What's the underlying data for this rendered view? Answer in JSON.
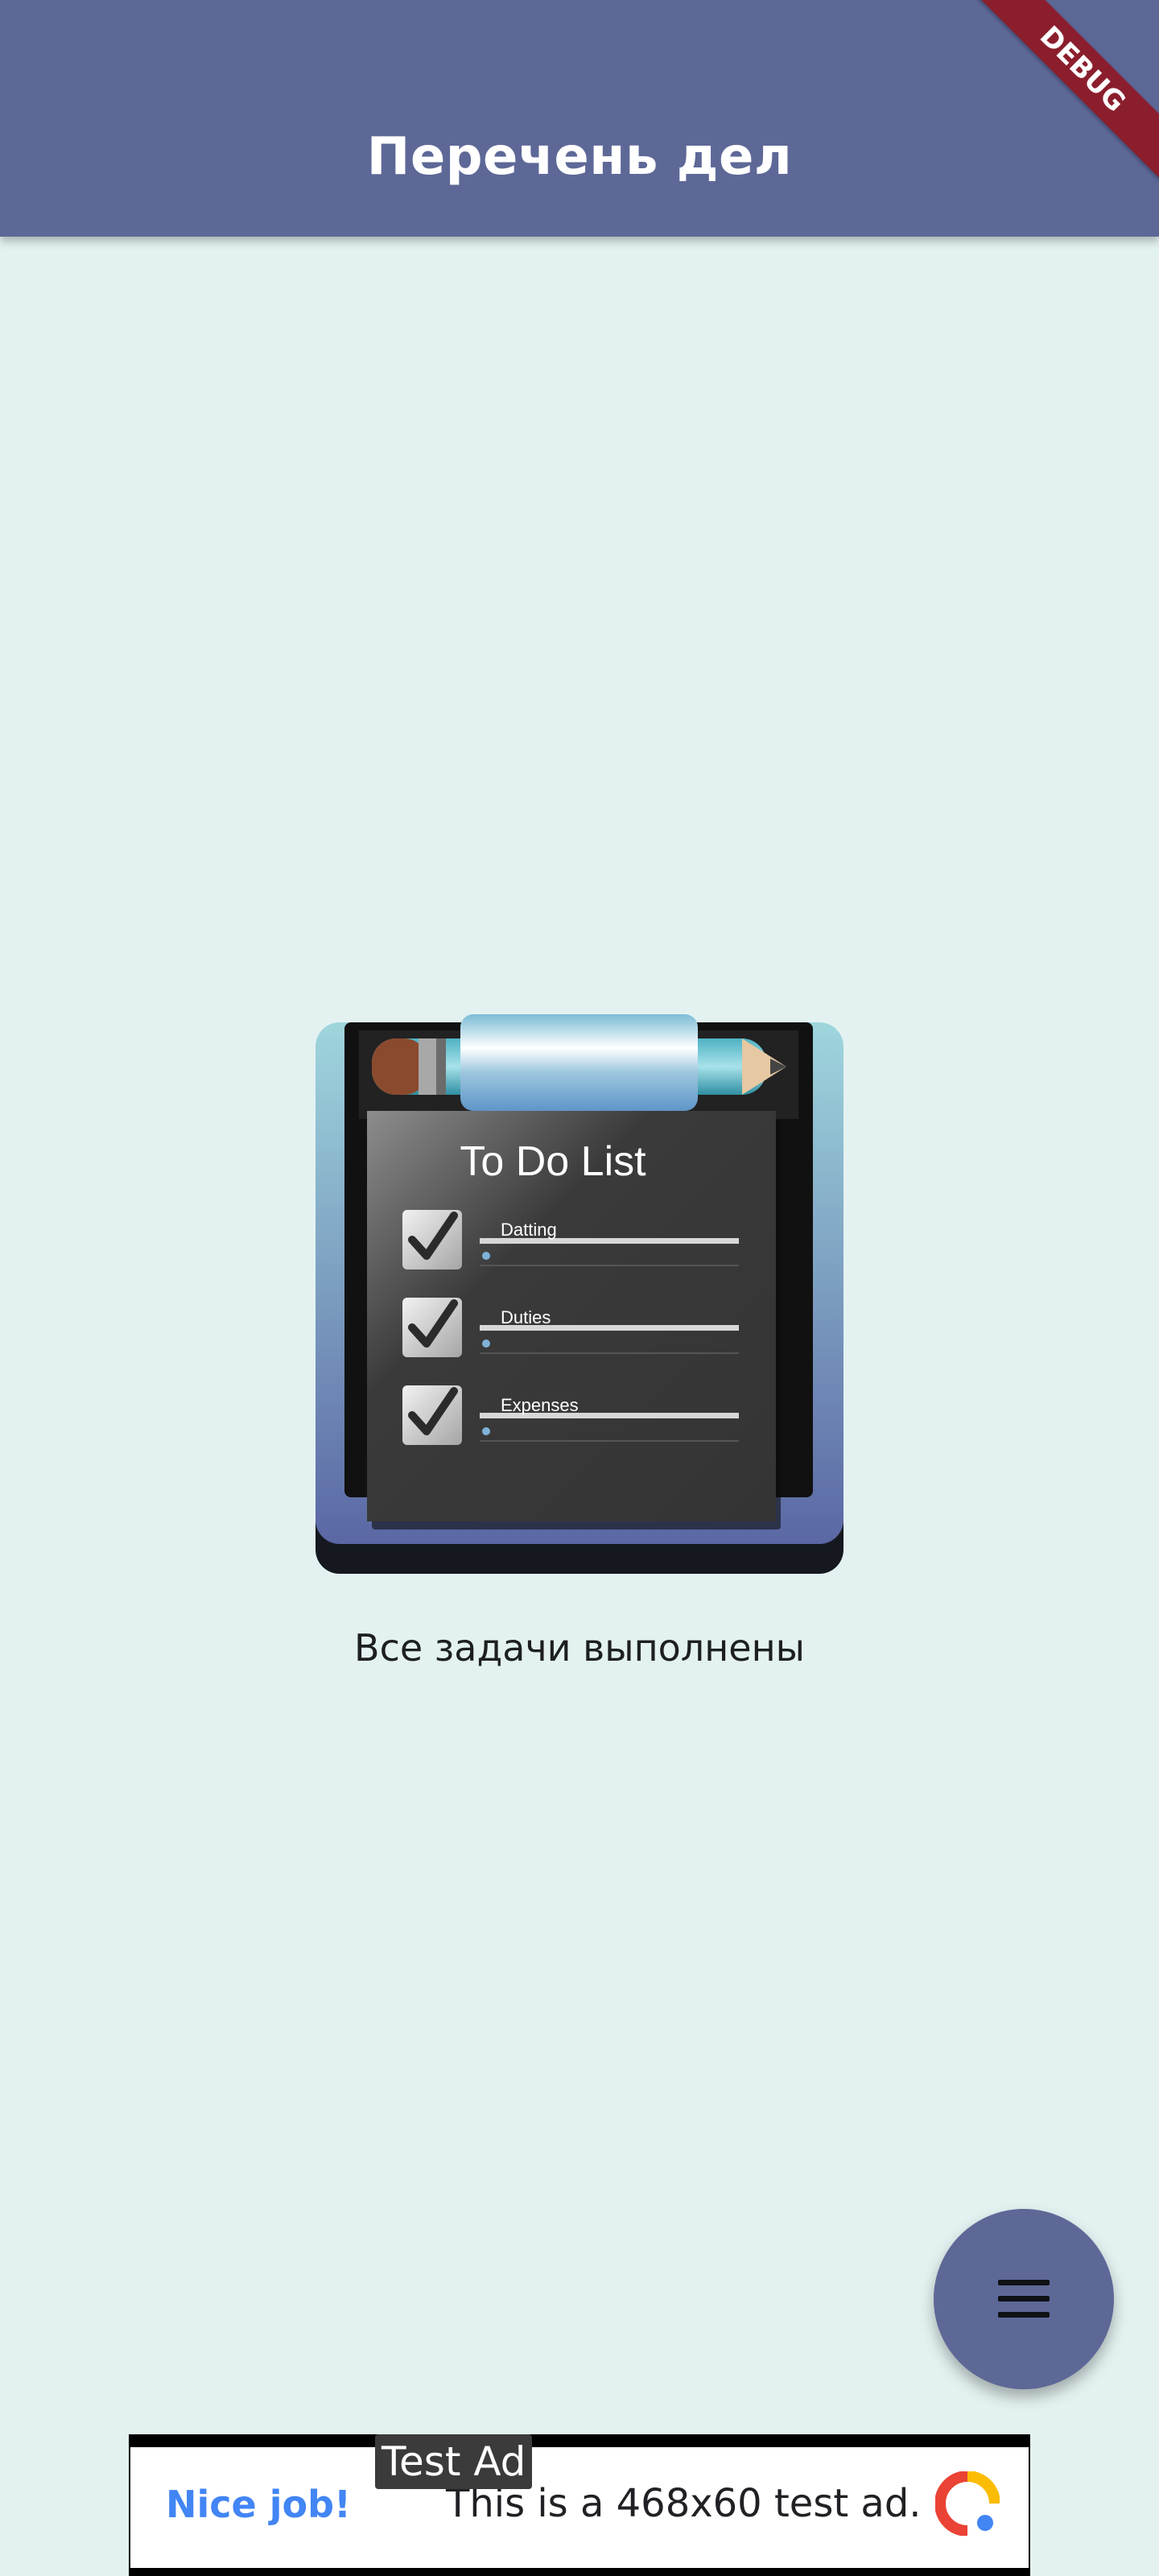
{
  "app_bar": {
    "title": "Перечень дел"
  },
  "debug_banner": {
    "label": "DEBUG",
    "color": "#8b1e2d"
  },
  "illustration": {
    "title": "To Do List",
    "items": [
      "Datting",
      "Duties",
      "Expenses"
    ]
  },
  "empty_state": {
    "message": "Все задачи выполнены"
  },
  "fab": {
    "icon": "menu-icon"
  },
  "ad": {
    "label": "Test Ad",
    "headline": "Nice job!",
    "text": "This is a 468x60 test ad.",
    "logo_icon": "ad-logo-icon"
  },
  "colors": {
    "app_bar": "#5e6897",
    "background": "#e3f2f1",
    "fab": "#5e6897"
  }
}
